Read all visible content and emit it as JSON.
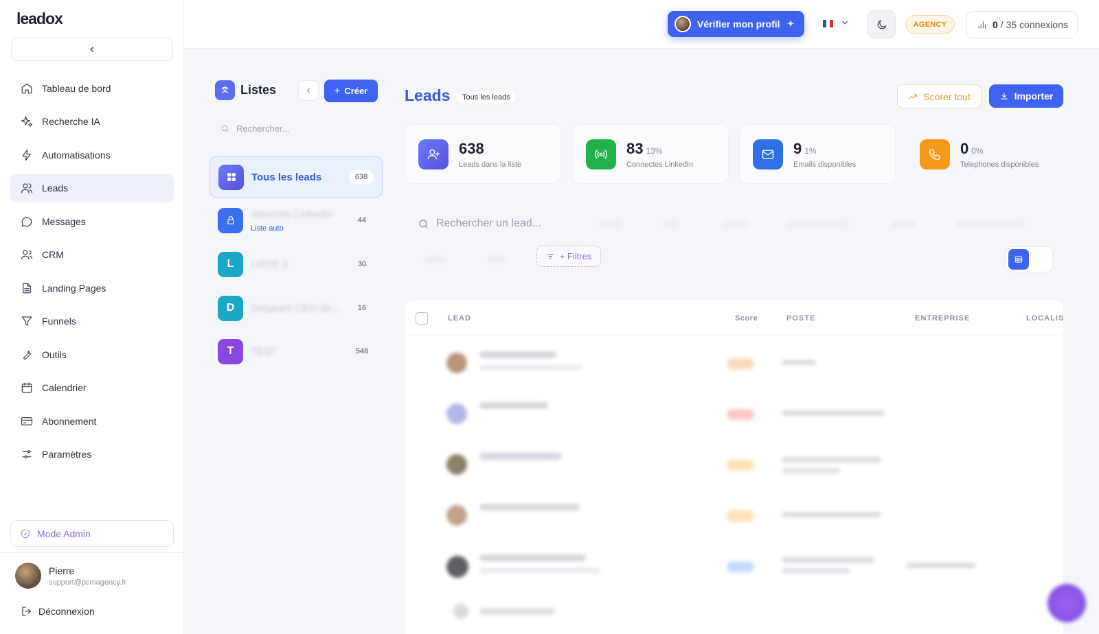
{
  "app": {
    "logo_text": "leadox"
  },
  "sidebar": {
    "items": [
      {
        "label": "Tableau de bord",
        "icon": "home-icon"
      },
      {
        "label": "Recherche IA",
        "icon": "sparkle-icon"
      },
      {
        "label": "Automatisations",
        "icon": "bolt-icon"
      },
      {
        "label": "Leads",
        "icon": "users-icon",
        "active": true
      },
      {
        "label": "Messages",
        "icon": "message-icon"
      },
      {
        "label": "CRM",
        "icon": "people-icon"
      },
      {
        "label": "Landing Pages",
        "icon": "document-icon"
      },
      {
        "label": "Funnels",
        "icon": "funnel-icon"
      },
      {
        "label": "Outils",
        "icon": "wrench-icon"
      },
      {
        "label": "Calendrier",
        "icon": "calendar-icon"
      },
      {
        "label": "Abonnement",
        "icon": "card-icon"
      },
      {
        "label": "Paramètres",
        "icon": "sliders-icon"
      }
    ],
    "admin_label": "Mode Admin",
    "user": {
      "name": "Pierre",
      "email": "support@pcmagency.fr"
    },
    "logout_label": "Déconnexion"
  },
  "topbar": {
    "verify_label": "Vérifier mon profil",
    "agency_badge": "AGENCY",
    "connections": {
      "used": "0",
      "rest": "/ 35 connexions"
    }
  },
  "lists": {
    "title": "Listes",
    "create_label": "Créer",
    "search_placeholder": "Rechercher...",
    "items": [
      {
        "name": "Tous les leads",
        "count": "638",
        "color": "#6366f1",
        "active": true
      },
      {
        "name": "Abonnés LinkedIn",
        "sub": "Liste auto",
        "count": "44",
        "color": "#3b6ff0"
      },
      {
        "name": "LISTE 2",
        "letter": "L",
        "count": "30",
        "color": "#1aa8c6"
      },
      {
        "name": "Dirigeant CEO dir...",
        "letter": "D",
        "count": "16",
        "color": "#1aa8c6"
      },
      {
        "name": "TEST",
        "letter": "T",
        "count": "548",
        "color": "#8b45e0"
      }
    ]
  },
  "main": {
    "title": "Leads",
    "pill": "Tous les leads",
    "score_all_label": "Scorer tout",
    "import_label": "Importer",
    "stats": [
      {
        "value": "638",
        "pct": "",
        "label": "Leads dans la liste",
        "color": "#6366f1",
        "icon": "user-plus-icon"
      },
      {
        "value": "83",
        "pct": "13%",
        "label": "Connectes LinkedIn",
        "color": "#22b24c",
        "icon": "signal-icon"
      },
      {
        "value": "9",
        "pct": "1%",
        "label": "Emails disponibles",
        "color": "#2f6fe8",
        "icon": "mail-icon"
      },
      {
        "value": "0",
        "pct": "0%",
        "label": "Telephones disponibles",
        "color": "#f59a1b",
        "icon": "phone-icon"
      }
    ],
    "search_placeholder": "Rechercher un lead...",
    "filters_label": "+ Filtres",
    "columns": {
      "lead": "LEAD",
      "score": "Score",
      "poste": "POSTE",
      "entreprise": "ENTREPRISE",
      "localisation": "LOCALISA"
    }
  }
}
